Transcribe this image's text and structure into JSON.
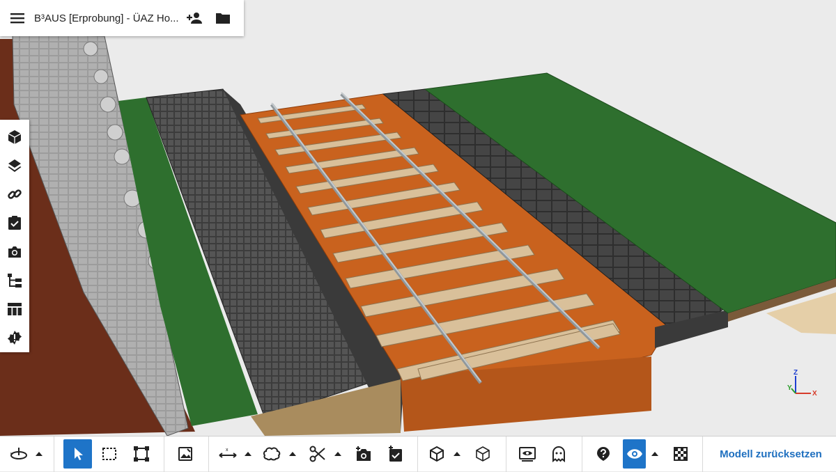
{
  "header": {
    "title": "B³AUS [Erprobung] - ÜAZ Ho...",
    "icons": [
      "menu-icon",
      "person-add-icon",
      "folder-icon"
    ]
  },
  "sidebar": {
    "items": [
      "cube-icon",
      "layers-icon",
      "link-icon",
      "clipboard-check-icon",
      "camera-icon",
      "tree-icon",
      "table-icon",
      "issue-badge-icon"
    ]
  },
  "toolbar": {
    "items": [
      "orbit-icon",
      "select-cursor-icon",
      "box-select-icon",
      "frame-select-icon",
      "image-icon",
      "measure-icon",
      "cloud-icon",
      "scissors-icon",
      "add-camera-icon",
      "add-task-icon",
      "cube-icon",
      "cube-outline-icon",
      "view-icon",
      "ghost-icon",
      "help-icon",
      "eye-icon",
      "checker-icon"
    ],
    "reset_label": "Modell zurücksetzen"
  },
  "colors": {
    "accent": "#1e74c8",
    "grass": "#2e6f2e",
    "ballast": "#c9621e",
    "concrete": "#4a4a4a",
    "soil": "#6a2d18"
  },
  "axis_gizmo": {
    "z_label": "Z",
    "y_label": "Y",
    "x_label": "X"
  }
}
